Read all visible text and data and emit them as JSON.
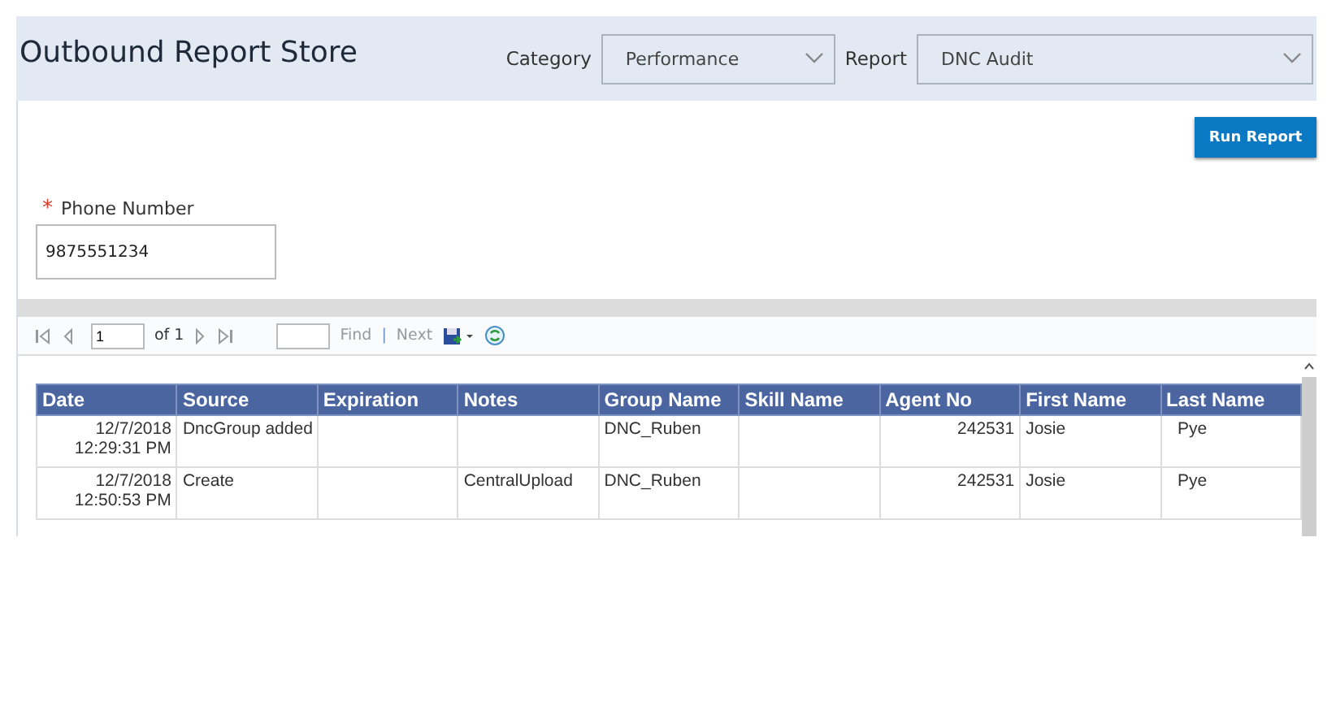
{
  "header": {
    "title": "Outbound Report Store",
    "filters": [
      {
        "label": "Category",
        "value": "Performance"
      },
      {
        "label": "Report",
        "value": "DNC Audit"
      }
    ]
  },
  "run_button": "Run Report",
  "parameter": {
    "required_mark": "*",
    "label": "Phone Number",
    "value": "9875551234"
  },
  "toolbar": {
    "page": "1",
    "of": "of 1",
    "find": "Find",
    "separator": "|",
    "next": "Next"
  },
  "table": {
    "columns": [
      "Date",
      "Source",
      "Expiration",
      "Notes",
      "Group Name",
      "Skill Name",
      "Agent No",
      "First Name",
      "Last Name"
    ],
    "rows": [
      [
        "12/7/2018 12:29:31 PM",
        "DncGroup added",
        "",
        "",
        "DNC_Ruben",
        "",
        "242531",
        "Josie",
        "Pye"
      ],
      [
        "12/7/2018 12:50:53 PM",
        "Create",
        "",
        "CentralUpload",
        "DNC_Ruben",
        "",
        "242531",
        "Josie",
        "Pye"
      ]
    ]
  }
}
